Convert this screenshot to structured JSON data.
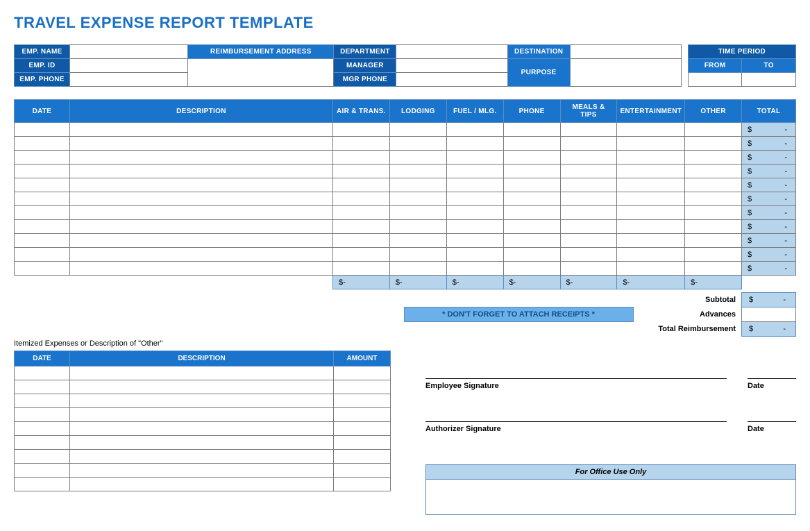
{
  "title": "TRAVEL EXPENSE REPORT TEMPLATE",
  "header": {
    "emp_name": "EMP. NAME",
    "emp_id": "EMP. ID",
    "emp_phone": "EMP. PHONE",
    "reimb_addr": "REIMBURSEMENT ADDRESS",
    "department": "DEPARTMENT",
    "manager": "MANAGER",
    "mgr_phone": "MGR PHONE",
    "destination": "DESTINATION",
    "purpose": "PURPOSE",
    "time_period": "TIME PERIOD",
    "from": "FROM",
    "to": "TO"
  },
  "columns": {
    "date": "DATE",
    "description": "DESCRIPTION",
    "air": "AIR & TRANS.",
    "lodging": "LODGING",
    "fuel": "FUEL / MLG.",
    "phone": "PHONE",
    "meals": "MEALS & TIPS",
    "ent": "ENTERTAINMENT",
    "other": "OTHER",
    "total": "TOTAL"
  },
  "expense_rows": 11,
  "currency": "$",
  "dash": "-",
  "receipts_note": "* DON'T FORGET TO ATTACH RECEIPTS *",
  "summary": {
    "subtotal": "Subtotal",
    "advances": "Advances",
    "total_reimb": "Total Reimbursement"
  },
  "itemized": {
    "caption": "Itemized Expenses or Description of \"Other\"",
    "date": "DATE",
    "description": "DESCRIPTION",
    "amount": "AMOUNT",
    "rows": 9
  },
  "signatures": {
    "employee": "Employee Signature",
    "authorizer": "Authorizer Signature",
    "date": "Date"
  },
  "office": "For Office Use Only"
}
